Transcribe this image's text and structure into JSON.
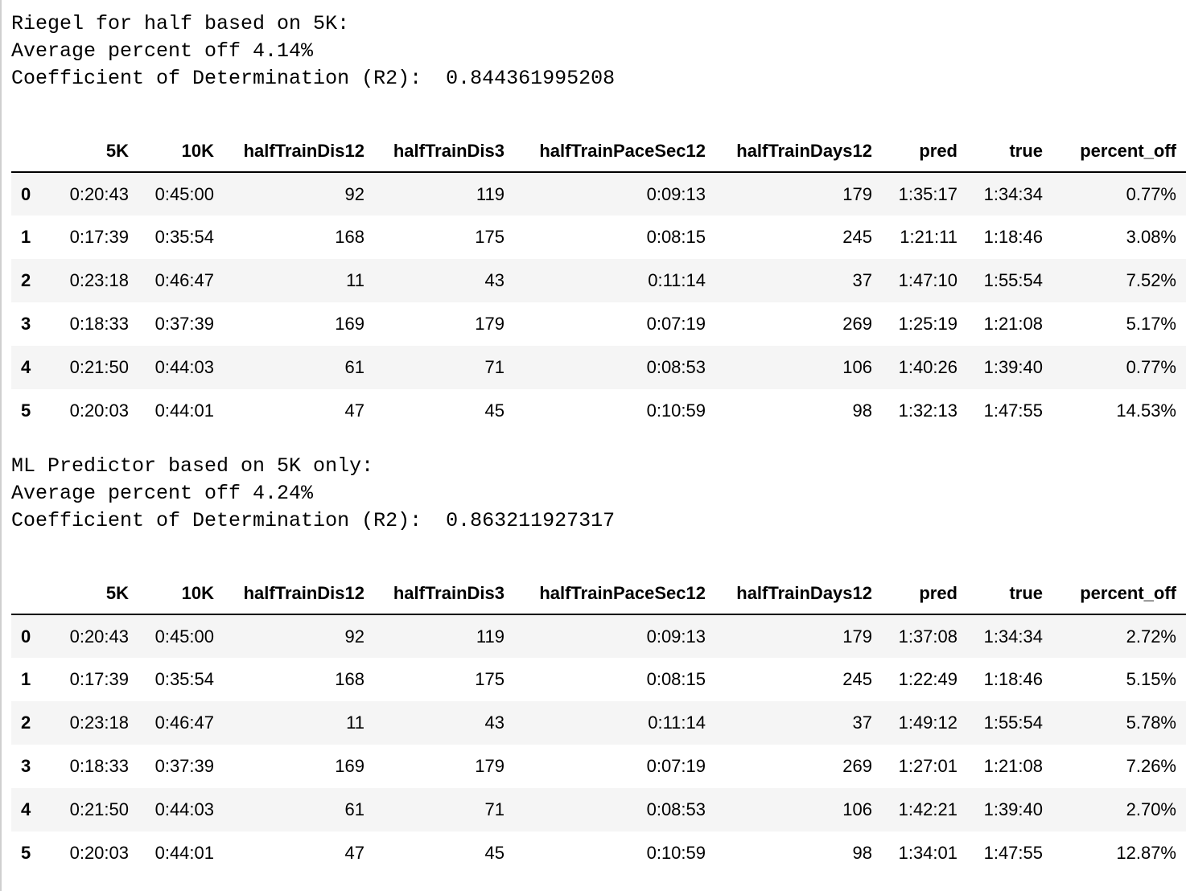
{
  "columns": [
    "5K",
    "10K",
    "halfTrainDis12",
    "halfTrainDis3",
    "halfTrainPaceSec12",
    "halfTrainDays12",
    "pred",
    "true",
    "percent_off"
  ],
  "blocks": [
    {
      "lines": [
        "Riegel for half based on 5K:",
        "Average percent off 4.14%",
        "Coefficient of Determination (R2):  0.844361995208"
      ],
      "rows": [
        {
          "index": "0",
          "cells": [
            "0:20:43",
            "0:45:00",
            "92",
            "119",
            "0:09:13",
            "179",
            "1:35:17",
            "1:34:34",
            "0.77%"
          ]
        },
        {
          "index": "1",
          "cells": [
            "0:17:39",
            "0:35:54",
            "168",
            "175",
            "0:08:15",
            "245",
            "1:21:11",
            "1:18:46",
            "3.08%"
          ]
        },
        {
          "index": "2",
          "cells": [
            "0:23:18",
            "0:46:47",
            "11",
            "43",
            "0:11:14",
            "37",
            "1:47:10",
            "1:55:54",
            "7.52%"
          ]
        },
        {
          "index": "3",
          "cells": [
            "0:18:33",
            "0:37:39",
            "169",
            "179",
            "0:07:19",
            "269",
            "1:25:19",
            "1:21:08",
            "5.17%"
          ]
        },
        {
          "index": "4",
          "cells": [
            "0:21:50",
            "0:44:03",
            "61",
            "71",
            "0:08:53",
            "106",
            "1:40:26",
            "1:39:40",
            "0.77%"
          ]
        },
        {
          "index": "5",
          "cells": [
            "0:20:03",
            "0:44:01",
            "47",
            "45",
            "0:10:59",
            "98",
            "1:32:13",
            "1:47:55",
            "14.53%"
          ]
        }
      ]
    },
    {
      "lines": [
        "ML Predictor based on 5K only:",
        "Average percent off 4.24%",
        "Coefficient of Determination (R2):  0.863211927317"
      ],
      "rows": [
        {
          "index": "0",
          "cells": [
            "0:20:43",
            "0:45:00",
            "92",
            "119",
            "0:09:13",
            "179",
            "1:37:08",
            "1:34:34",
            "2.72%"
          ]
        },
        {
          "index": "1",
          "cells": [
            "0:17:39",
            "0:35:54",
            "168",
            "175",
            "0:08:15",
            "245",
            "1:22:49",
            "1:18:46",
            "5.15%"
          ]
        },
        {
          "index": "2",
          "cells": [
            "0:23:18",
            "0:46:47",
            "11",
            "43",
            "0:11:14",
            "37",
            "1:49:12",
            "1:55:54",
            "5.78%"
          ]
        },
        {
          "index": "3",
          "cells": [
            "0:18:33",
            "0:37:39",
            "169",
            "179",
            "0:07:19",
            "269",
            "1:27:01",
            "1:21:08",
            "7.26%"
          ]
        },
        {
          "index": "4",
          "cells": [
            "0:21:50",
            "0:44:03",
            "61",
            "71",
            "0:08:53",
            "106",
            "1:42:21",
            "1:39:40",
            "2.70%"
          ]
        },
        {
          "index": "5",
          "cells": [
            "0:20:03",
            "0:44:01",
            "47",
            "45",
            "0:10:59",
            "98",
            "1:34:01",
            "1:47:55",
            "12.87%"
          ]
        }
      ]
    }
  ]
}
